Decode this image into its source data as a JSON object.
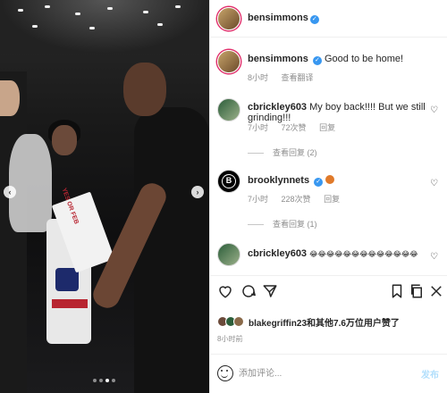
{
  "photo": {
    "sign_text": "YES OR FEB",
    "carousel": {
      "prev": "‹",
      "next": "›",
      "slide_count": 4,
      "active_index": 2
    }
  },
  "header": {
    "username": "bensimmons",
    "verified": "✓"
  },
  "caption": {
    "username": "bensimmons",
    "text": "Good to be home!",
    "time": "8小时",
    "translate": "查看翻译"
  },
  "comments": [
    {
      "username": "cbrickley603",
      "text": "My boy back!!!! But we still grinding!!!",
      "time": "7小时",
      "likes": "72次赞",
      "reply": "回复",
      "view_replies": "查看回复 (2)"
    },
    {
      "username": "brooklynnets",
      "verified": "✓",
      "time": "7小时",
      "likes": "228次赞",
      "reply": "回复",
      "view_replies": "查看回复 (1)"
    },
    {
      "username": "cbrickley603",
      "text": "😂😂😂😂😂😂😂😂😂😂😂😂😂"
    }
  ],
  "nets_logo": "B",
  "actions": {
    "like": "like",
    "comment": "comment",
    "share": "share",
    "bookmark": "bookmark",
    "copy": "copy",
    "more": "more"
  },
  "likes": {
    "text": "blakegriffin23和其他7.6万位用户赞了"
  },
  "post_time": "8小时前",
  "comment_box": {
    "placeholder": "添加评论...",
    "post": "发布"
  },
  "colors": {
    "verified": "#3897f0",
    "story_ring": "#e1306c",
    "post_button": "#b2dffc"
  }
}
